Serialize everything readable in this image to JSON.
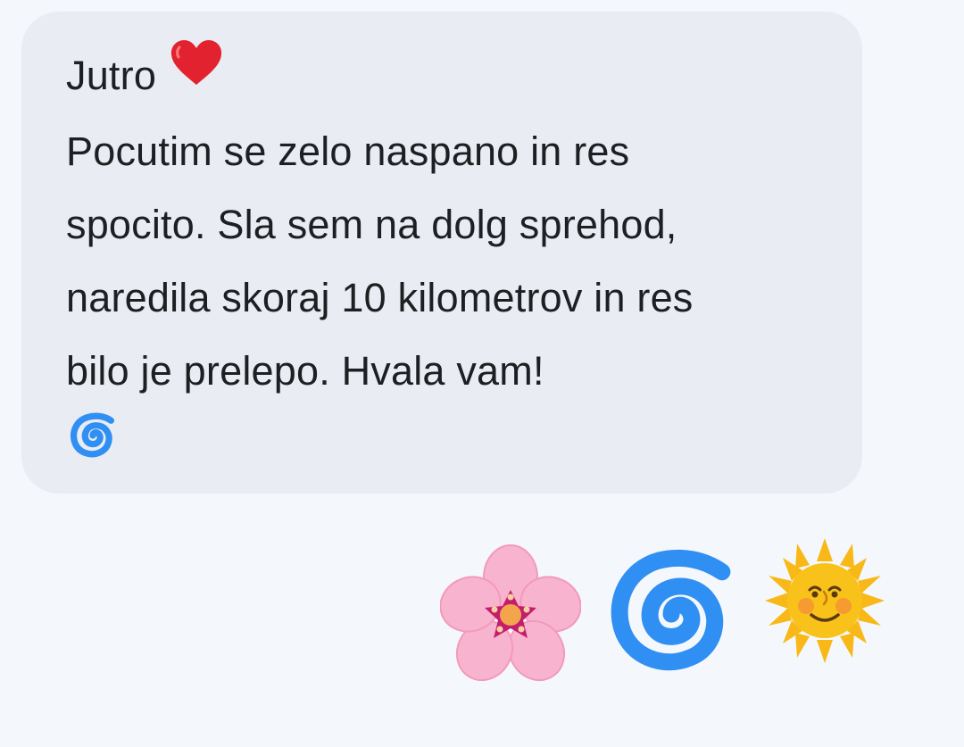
{
  "message": {
    "greeting": "Jutro",
    "lines": [
      "Pocutim se zelo naspano in res",
      "spocito. Sla sem na dolg sprehod,",
      "naredila skoraj 10 kilometrov in res",
      "bilo je prelepo. Hvala vam!"
    ],
    "inline_emoji": [
      "heart-icon",
      "cyclone-icon"
    ]
  },
  "reactions": {
    "emojis": [
      "cherry-blossom-icon",
      "cyclone-icon",
      "sun-with-face-icon"
    ]
  },
  "colors": {
    "background": "#f4f8fc",
    "bubble": "#e9ecf2",
    "text": "#1e1f22",
    "heart": "#e3222f",
    "cyclone": "#2f8ff2",
    "blossom": "#f8b4cf",
    "sun": "#f8b817"
  }
}
